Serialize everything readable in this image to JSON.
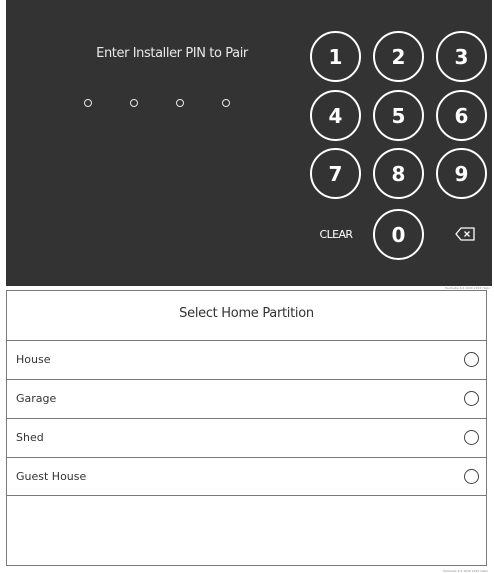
{
  "pin_pad": {
    "prompt": "Enter Installer PIN to Pair",
    "pin_length": 4,
    "keys": [
      "1",
      "2",
      "3",
      "4",
      "5",
      "6",
      "7",
      "8",
      "9",
      "0"
    ],
    "clear_label": "CLEAR",
    "backspace_icon": "backspace-icon",
    "caption": "PeriSuite 4.0 1030 2015 Hello"
  },
  "partition_dialog": {
    "title": "Select Home Partition",
    "options": [
      {
        "label": "House",
        "selected": false
      },
      {
        "label": "Garage",
        "selected": false
      },
      {
        "label": "Shed",
        "selected": false
      },
      {
        "label": "Guest House",
        "selected": false
      }
    ],
    "caption": "PeriSuite 4.0 1030 2015 Hello"
  },
  "colors": {
    "pad_background": "#333333",
    "key_outline": "#ffffff",
    "divider": "#7a7a7a"
  }
}
